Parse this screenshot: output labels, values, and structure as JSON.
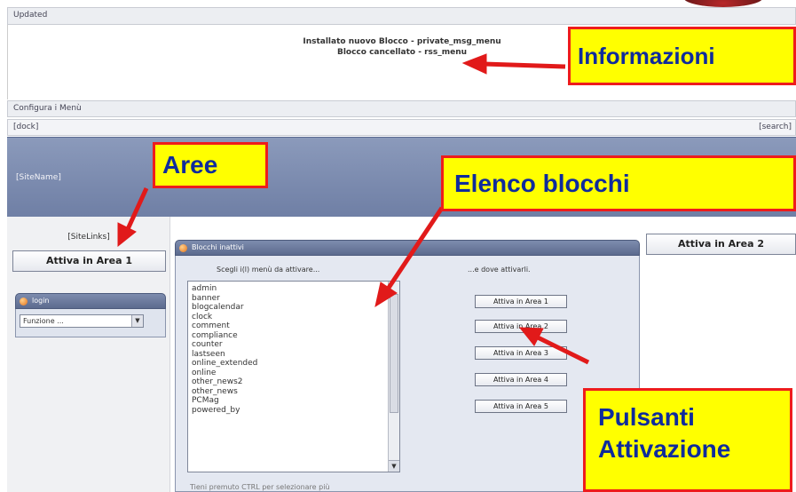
{
  "status_bar": {
    "title": "Updated"
  },
  "info_messages": [
    "Installato nuovo Blocco - private_msg_menu",
    "Blocco cancellato - rss_menu"
  ],
  "config_bar": {
    "title": "Configura i Menù"
  },
  "dock_bar": {
    "left": "[dock]",
    "right": "[search]"
  },
  "header": {
    "sitename": "[SiteName]"
  },
  "left_column": {
    "sitelinks": "[SiteLinks]",
    "area1_button": "Attiva in Area 1",
    "login_panel": {
      "title": "login",
      "select_value": "Funzione ..."
    }
  },
  "blocks_panel": {
    "title": "Blocchi inattivi",
    "choose_label": "Scegli i(l) menù da attivare...",
    "where_label": "...e dove attivarli.",
    "blocks": [
      "admin",
      "banner",
      "blogcalendar",
      "clock",
      "comment",
      "compliance",
      "counter",
      "lastseen",
      "online_extended",
      "online",
      "other_news2",
      "other_news",
      "PCMag",
      "powered_by"
    ],
    "activate_buttons": [
      "Attiva in Area 1",
      "Attiva in Area 2",
      "Attiva in Area 3",
      "Attiva in Area 4",
      "Attiva in Area 5"
    ],
    "hint": "Tieni premuto CTRL per selezionare più"
  },
  "right_column": {
    "area2_button": "Attiva in Area 2"
  },
  "callouts": {
    "informazioni": "Informazioni",
    "aree": "Aree",
    "elenco_blocchi": "Elenco blocchi",
    "pulsanti_line1": "Pulsanti",
    "pulsanti_line2": "Attivazione"
  },
  "colors": {
    "callout_fill": "#ffff00",
    "callout_border": "#ee1c1c",
    "callout_text": "#0f2b9c",
    "arrow": "#e11a1a",
    "header_band": "#7585aa"
  },
  "icons": {
    "panel_bullet": "orange-dot-icon",
    "dropdown": "chevron-down-icon",
    "scroll_down": "arrow-down-icon"
  }
}
